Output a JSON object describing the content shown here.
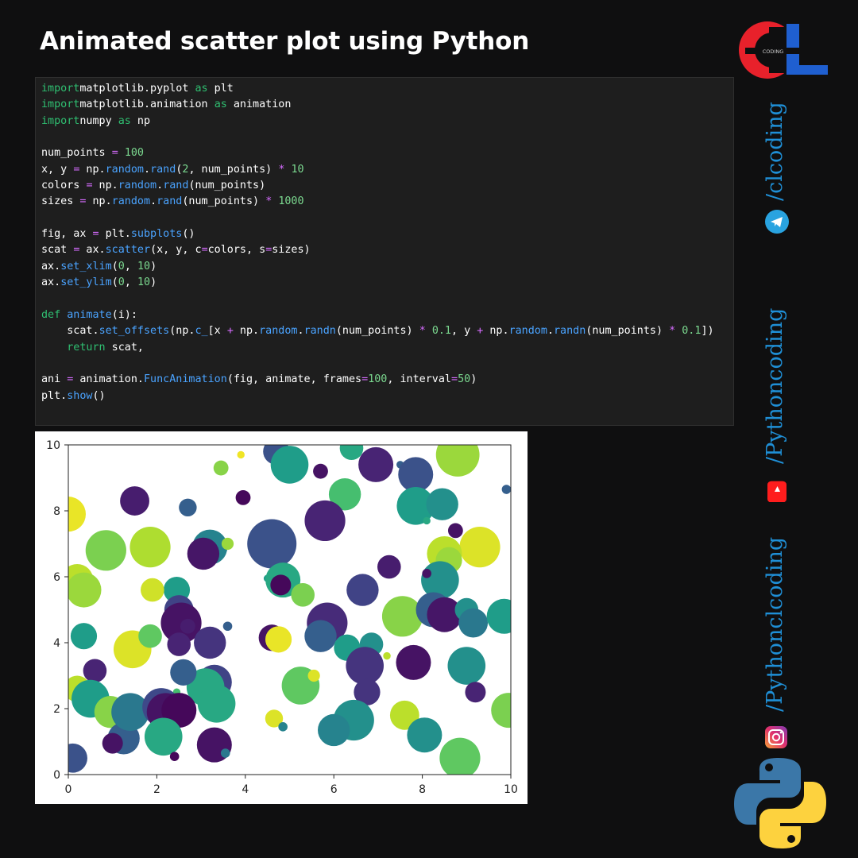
{
  "title": "Animated scatter plot using Python",
  "code_lines": [
    [
      [
        "kw",
        "import"
      ],
      [
        "",
        "matplotlib.pyplot "
      ],
      [
        "kw",
        "as"
      ],
      [
        "",
        " plt"
      ]
    ],
    [
      [
        "kw",
        "import"
      ],
      [
        "",
        "matplotlib.animation "
      ],
      [
        "kw",
        "as"
      ],
      [
        "",
        " animation"
      ]
    ],
    [
      [
        "kw",
        "import"
      ],
      [
        "",
        "numpy "
      ],
      [
        "kw",
        "as"
      ],
      [
        "",
        " np"
      ]
    ],
    [],
    [
      [
        "",
        "num_points "
      ],
      [
        "op",
        "="
      ],
      [
        "",
        " "
      ],
      [
        "num",
        "100"
      ]
    ],
    [
      [
        "",
        "x, y "
      ],
      [
        "op",
        "="
      ],
      [
        "",
        " np."
      ],
      [
        "fn",
        "random"
      ],
      [
        "",
        "."
      ],
      [
        "fn",
        "rand"
      ],
      [
        "",
        "("
      ],
      [
        "num",
        "2"
      ],
      [
        "",
        ", num_points) "
      ],
      [
        "op",
        "*"
      ],
      [
        "",
        " "
      ],
      [
        "num",
        "10"
      ]
    ],
    [
      [
        "",
        "colors "
      ],
      [
        "op",
        "="
      ],
      [
        "",
        " np."
      ],
      [
        "fn",
        "random"
      ],
      [
        "",
        "."
      ],
      [
        "fn",
        "rand"
      ],
      [
        "",
        "(num_points)"
      ]
    ],
    [
      [
        "",
        "sizes "
      ],
      [
        "op",
        "="
      ],
      [
        "",
        " np."
      ],
      [
        "fn",
        "random"
      ],
      [
        "",
        "."
      ],
      [
        "fn",
        "rand"
      ],
      [
        "",
        "(num_points) "
      ],
      [
        "op",
        "*"
      ],
      [
        "",
        " "
      ],
      [
        "num",
        "1000"
      ]
    ],
    [],
    [
      [
        "",
        "fig, ax "
      ],
      [
        "op",
        "="
      ],
      [
        "",
        " plt."
      ],
      [
        "fn",
        "subplots"
      ],
      [
        "",
        "()"
      ]
    ],
    [
      [
        "",
        "scat "
      ],
      [
        "op",
        "="
      ],
      [
        "",
        " ax."
      ],
      [
        "fn",
        "scatter"
      ],
      [
        "",
        "(x, y, c"
      ],
      [
        "op",
        "="
      ],
      [
        "",
        "colors, s"
      ],
      [
        "op",
        "="
      ],
      [
        "",
        "sizes)"
      ]
    ],
    [
      [
        "",
        "ax."
      ],
      [
        "fn",
        "set_xlim"
      ],
      [
        "",
        "("
      ],
      [
        "num",
        "0"
      ],
      [
        "",
        ", "
      ],
      [
        "num",
        "10"
      ],
      [
        "",
        ")"
      ]
    ],
    [
      [
        "",
        "ax."
      ],
      [
        "fn",
        "set_ylim"
      ],
      [
        "",
        "("
      ],
      [
        "num",
        "0"
      ],
      [
        "",
        ", "
      ],
      [
        "num",
        "10"
      ],
      [
        "",
        ")"
      ]
    ],
    [],
    [
      [
        "kw",
        "def"
      ],
      [
        "",
        " "
      ],
      [
        "fn",
        "animate"
      ],
      [
        "",
        "(i):"
      ]
    ],
    [
      [
        "",
        "    scat."
      ],
      [
        "fn",
        "set_offsets"
      ],
      [
        "",
        "(np."
      ],
      [
        "fn",
        "c_"
      ],
      [
        "",
        "[x "
      ],
      [
        "op",
        "+"
      ],
      [
        "",
        " np."
      ],
      [
        "fn",
        "random"
      ],
      [
        "",
        "."
      ],
      [
        "fn",
        "randn"
      ],
      [
        "",
        "(num_points) "
      ],
      [
        "op",
        "*"
      ],
      [
        "",
        " "
      ],
      [
        "num",
        "0.1"
      ],
      [
        "",
        ", y "
      ],
      [
        "op",
        "+"
      ],
      [
        "",
        " np."
      ],
      [
        "fn",
        "random"
      ],
      [
        "",
        "."
      ],
      [
        "fn",
        "randn"
      ],
      [
        "",
        "(num_points) "
      ],
      [
        "op",
        "*"
      ],
      [
        "",
        " "
      ],
      [
        "num",
        "0.1"
      ],
      [
        "",
        "])"
      ]
    ],
    [
      [
        "kw",
        "    return"
      ],
      [
        "",
        " scat,"
      ]
    ],
    [],
    [
      [
        "",
        "ani "
      ],
      [
        "op",
        "="
      ],
      [
        "",
        " animation."
      ],
      [
        "fn",
        "FuncAnimation"
      ],
      [
        "",
        "(fig, animate, frames"
      ],
      [
        "op",
        "="
      ],
      [
        "num",
        "100"
      ],
      [
        "",
        ", interval"
      ],
      [
        "op",
        "="
      ],
      [
        "num",
        "50"
      ],
      [
        "",
        ")"
      ]
    ],
    [
      [
        "",
        "plt."
      ],
      [
        "fn",
        "show"
      ],
      [
        "",
        "()"
      ]
    ]
  ],
  "chart_data": {
    "type": "scatter",
    "xlim": [
      0,
      10
    ],
    "ylim": [
      0,
      10
    ],
    "xticks": [
      0,
      2,
      4,
      6,
      8,
      10
    ],
    "yticks": [
      0,
      2,
      4,
      6,
      8,
      10
    ],
    "grid": false,
    "colormap": "viridis",
    "points": [
      {
        "x": 0.0,
        "y": 7.9,
        "s": 0.5,
        "c": 0.97
      },
      {
        "x": 0.2,
        "y": 5.9,
        "s": 0.45,
        "c": 0.9
      },
      {
        "x": 0.35,
        "y": 5.6,
        "s": 0.5,
        "c": 0.85
      },
      {
        "x": 0.85,
        "y": 6.8,
        "s": 0.6,
        "c": 0.8
      },
      {
        "x": 1.5,
        "y": 8.3,
        "s": 0.4,
        "c": 0.08
      },
      {
        "x": 1.85,
        "y": 6.9,
        "s": 0.6,
        "c": 0.88
      },
      {
        "x": 2.7,
        "y": 8.1,
        "s": 0.2,
        "c": 0.3
      },
      {
        "x": 3.45,
        "y": 9.3,
        "s": 0.15,
        "c": 0.82
      },
      {
        "x": 3.9,
        "y": 9.7,
        "s": 0.02,
        "c": 0.98
      },
      {
        "x": 3.95,
        "y": 8.4,
        "s": 0.15,
        "c": 0.02
      },
      {
        "x": 4.7,
        "y": 9.8,
        "s": 0.35,
        "c": 0.25
      },
      {
        "x": 5.0,
        "y": 9.4,
        "s": 0.55,
        "c": 0.55
      },
      {
        "x": 5.7,
        "y": 9.2,
        "s": 0.15,
        "c": 0.05
      },
      {
        "x": 6.25,
        "y": 8.5,
        "s": 0.45,
        "c": 0.7
      },
      {
        "x": 6.4,
        "y": 9.9,
        "s": 0.3,
        "c": 0.6
      },
      {
        "x": 6.95,
        "y": 9.4,
        "s": 0.5,
        "c": 0.1
      },
      {
        "x": 7.5,
        "y": 9.4,
        "s": 0.02,
        "c": 0.3
      },
      {
        "x": 7.85,
        "y": 9.1,
        "s": 0.5,
        "c": 0.25
      },
      {
        "x": 8.8,
        "y": 9.7,
        "s": 0.65,
        "c": 0.85
      },
      {
        "x": 9.9,
        "y": 8.65,
        "s": 0.05,
        "c": 0.3
      },
      {
        "x": 7.85,
        "y": 8.15,
        "s": 0.55,
        "c": 0.55
      },
      {
        "x": 8.45,
        "y": 8.2,
        "s": 0.45,
        "c": 0.5
      },
      {
        "x": 5.8,
        "y": 7.7,
        "s": 0.6,
        "c": 0.1
      },
      {
        "x": 8.1,
        "y": 7.7,
        "s": 0.02,
        "c": 0.6
      },
      {
        "x": 4.6,
        "y": 7.0,
        "s": 0.75,
        "c": 0.25
      },
      {
        "x": 3.2,
        "y": 6.9,
        "s": 0.5,
        "c": 0.45
      },
      {
        "x": 3.05,
        "y": 6.7,
        "s": 0.45,
        "c": 0.06
      },
      {
        "x": 3.6,
        "y": 7.0,
        "s": 0.1,
        "c": 0.85
      },
      {
        "x": 9.3,
        "y": 6.9,
        "s": 0.6,
        "c": 0.95
      },
      {
        "x": 8.75,
        "y": 7.4,
        "s": 0.15,
        "c": 0.05
      },
      {
        "x": 8.5,
        "y": 6.7,
        "s": 0.5,
        "c": 0.9
      },
      {
        "x": 8.6,
        "y": 6.5,
        "s": 0.35,
        "c": 0.85
      },
      {
        "x": 7.25,
        "y": 6.3,
        "s": 0.3,
        "c": 0.08
      },
      {
        "x": 8.4,
        "y": 5.9,
        "s": 0.55,
        "c": 0.5
      },
      {
        "x": 8.1,
        "y": 6.1,
        "s": 0.05,
        "c": 0.05
      },
      {
        "x": 6.65,
        "y": 5.6,
        "s": 0.45,
        "c": 0.2
      },
      {
        "x": 4.5,
        "y": 5.95,
        "s": 0.02,
        "c": 0.55
      },
      {
        "x": 4.85,
        "y": 5.9,
        "s": 0.5,
        "c": 0.6
      },
      {
        "x": 4.8,
        "y": 5.75,
        "s": 0.25,
        "c": 0.02
      },
      {
        "x": 5.3,
        "y": 5.45,
        "s": 0.3,
        "c": 0.8
      },
      {
        "x": 2.45,
        "y": 5.6,
        "s": 0.35,
        "c": 0.55
      },
      {
        "x": 1.9,
        "y": 5.6,
        "s": 0.3,
        "c": 0.93
      },
      {
        "x": 2.5,
        "y": 5.0,
        "s": 0.4,
        "c": 0.2
      },
      {
        "x": 2.55,
        "y": 4.6,
        "s": 0.6,
        "c": 0.05
      },
      {
        "x": 2.5,
        "y": 3.95,
        "s": 0.3,
        "c": 0.1
      },
      {
        "x": 2.7,
        "y": 4.5,
        "s": 0.15,
        "c": 0.08
      },
      {
        "x": 3.2,
        "y": 4.0,
        "s": 0.45,
        "c": 0.15
      },
      {
        "x": 3.6,
        "y": 4.5,
        "s": 0.05,
        "c": 0.3
      },
      {
        "x": 1.45,
        "y": 3.8,
        "s": 0.55,
        "c": 0.95
      },
      {
        "x": 1.85,
        "y": 4.2,
        "s": 0.3,
        "c": 0.75
      },
      {
        "x": 0.35,
        "y": 4.2,
        "s": 0.35,
        "c": 0.55
      },
      {
        "x": 0.6,
        "y": 3.15,
        "s": 0.3,
        "c": 0.1
      },
      {
        "x": 0.2,
        "y": 2.6,
        "s": 0.35,
        "c": 0.9
      },
      {
        "x": 4.6,
        "y": 4.15,
        "s": 0.35,
        "c": 0.05
      },
      {
        "x": 4.75,
        "y": 4.1,
        "s": 0.35,
        "c": 0.97
      },
      {
        "x": 5.85,
        "y": 4.6,
        "s": 0.6,
        "c": 0.12
      },
      {
        "x": 5.7,
        "y": 4.2,
        "s": 0.45,
        "c": 0.3
      },
      {
        "x": 6.3,
        "y": 3.85,
        "s": 0.35,
        "c": 0.55
      },
      {
        "x": 6.85,
        "y": 3.95,
        "s": 0.3,
        "c": 0.5
      },
      {
        "x": 7.2,
        "y": 3.6,
        "s": 0.02,
        "c": 0.9
      },
      {
        "x": 6.7,
        "y": 3.3,
        "s": 0.55,
        "c": 0.15
      },
      {
        "x": 6.75,
        "y": 2.5,
        "s": 0.35,
        "c": 0.15
      },
      {
        "x": 7.55,
        "y": 4.8,
        "s": 0.6,
        "c": 0.82
      },
      {
        "x": 7.8,
        "y": 3.4,
        "s": 0.5,
        "c": 0.05
      },
      {
        "x": 8.25,
        "y": 5.0,
        "s": 0.5,
        "c": 0.3
      },
      {
        "x": 8.5,
        "y": 4.85,
        "s": 0.5,
        "c": 0.06
      },
      {
        "x": 9.0,
        "y": 5.0,
        "s": 0.3,
        "c": 0.5
      },
      {
        "x": 9.15,
        "y": 4.6,
        "s": 0.4,
        "c": 0.4
      },
      {
        "x": 9.85,
        "y": 4.8,
        "s": 0.5,
        "c": 0.55
      },
      {
        "x": 9.0,
        "y": 3.3,
        "s": 0.55,
        "c": 0.5
      },
      {
        "x": 9.2,
        "y": 2.5,
        "s": 0.25,
        "c": 0.1
      },
      {
        "x": 9.95,
        "y": 1.95,
        "s": 0.5,
        "c": 0.8
      },
      {
        "x": 3.3,
        "y": 2.8,
        "s": 0.5,
        "c": 0.2
      },
      {
        "x": 3.1,
        "y": 2.65,
        "s": 0.55,
        "c": 0.6
      },
      {
        "x": 3.35,
        "y": 2.15,
        "s": 0.55,
        "c": 0.6
      },
      {
        "x": 2.6,
        "y": 3.1,
        "s": 0.35,
        "c": 0.3
      },
      {
        "x": 2.45,
        "y": 2.5,
        "s": 0.02,
        "c": 0.7
      },
      {
        "x": 5.25,
        "y": 2.7,
        "s": 0.55,
        "c": 0.75
      },
      {
        "x": 5.55,
        "y": 3.0,
        "s": 0.1,
        "c": 0.95
      },
      {
        "x": 7.6,
        "y": 1.8,
        "s": 0.4,
        "c": 0.9
      },
      {
        "x": 6.45,
        "y": 1.65,
        "s": 0.6,
        "c": 0.5
      },
      {
        "x": 6.0,
        "y": 1.35,
        "s": 0.45,
        "c": 0.45
      },
      {
        "x": 8.05,
        "y": 1.2,
        "s": 0.5,
        "c": 0.5
      },
      {
        "x": 8.85,
        "y": 0.5,
        "s": 0.6,
        "c": 0.75
      },
      {
        "x": 0.5,
        "y": 2.3,
        "s": 0.55,
        "c": 0.55
      },
      {
        "x": 0.95,
        "y": 1.9,
        "s": 0.45,
        "c": 0.82
      },
      {
        "x": 1.25,
        "y": 1.1,
        "s": 0.45,
        "c": 0.3
      },
      {
        "x": 1.0,
        "y": 0.95,
        "s": 0.25,
        "c": 0.05
      },
      {
        "x": 1.4,
        "y": 1.9,
        "s": 0.55,
        "c": 0.4
      },
      {
        "x": 2.1,
        "y": 2.05,
        "s": 0.55,
        "c": 0.22
      },
      {
        "x": 2.2,
        "y": 1.9,
        "s": 0.55,
        "c": 0.05
      },
      {
        "x": 2.5,
        "y": 1.95,
        "s": 0.5,
        "c": 0.02
      },
      {
        "x": 2.15,
        "y": 1.15,
        "s": 0.55,
        "c": 0.6
      },
      {
        "x": 2.4,
        "y": 0.55,
        "s": 0.05,
        "c": 0.02
      },
      {
        "x": 3.3,
        "y": 0.9,
        "s": 0.5,
        "c": 0.05
      },
      {
        "x": 3.55,
        "y": 0.65,
        "s": 0.05,
        "c": 0.4
      },
      {
        "x": 4.65,
        "y": 1.7,
        "s": 0.2,
        "c": 0.95
      },
      {
        "x": 4.85,
        "y": 1.45,
        "s": 0.05,
        "c": 0.45
      },
      {
        "x": 0.1,
        "y": 0.5,
        "s": 0.4,
        "c": 0.25
      }
    ]
  },
  "sidebar": {
    "logo_text": "CL",
    "logo_small": "CODING",
    "handles": [
      "/clcoding",
      "/Pythoncoding",
      "/Pythonclcoding"
    ],
    "colors": {
      "brand_red": "#e8212b",
      "brand_blue": "#1f5fd0",
      "handle": "#1f8fd6"
    }
  }
}
